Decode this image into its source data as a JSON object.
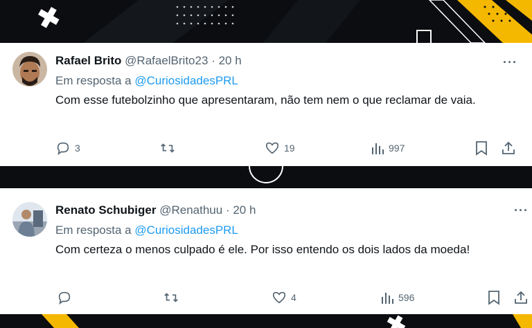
{
  "colors": {
    "background": "#0b0d10",
    "accent_yellow": "#f5b800",
    "link_blue": "#1d9bf0",
    "text_primary": "#0f1419",
    "text_secondary": "#536471"
  },
  "tweets": [
    {
      "name": "Rafael Brito",
      "handle": "@RafaelBrito23",
      "separator": "·",
      "time": "20 h",
      "reply_prefix": "Em resposta a",
      "reply_handle": "@CuriosidadesPRL",
      "text": "Com esse futebolzinho que apresentaram, não tem nem o que reclamar de vaia.",
      "more": "···",
      "replies": "3",
      "retweets": "",
      "likes": "19",
      "views": "997",
      "icons": [
        "reply-icon",
        "retweet-icon",
        "like-icon",
        "views-icon",
        "bookmark-icon",
        "share-icon"
      ]
    },
    {
      "name": "Renato Schubiger",
      "handle": "@Renathuu",
      "separator": "·",
      "time": "20 h",
      "reply_prefix": "Em resposta a",
      "reply_handle": "@CuriosidadesPRL",
      "text": "Com certeza o menos culpado é ele. Por isso entendo os dois lados da moeda!",
      "more": "···",
      "replies": "",
      "retweets": "",
      "likes": "4",
      "views": "596",
      "icons": [
        "reply-icon",
        "retweet-icon",
        "like-icon",
        "views-icon",
        "bookmark-icon",
        "share-icon"
      ]
    }
  ]
}
